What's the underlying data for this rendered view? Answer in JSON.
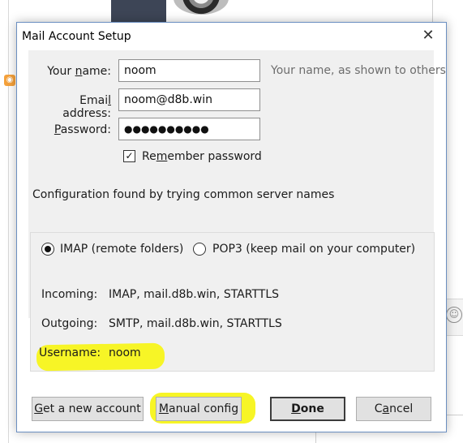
{
  "dialog": {
    "title": "Mail Account Setup",
    "close_label": "✕"
  },
  "form": {
    "name_label": "Your name:",
    "name_value": "noom",
    "name_hint": "Your name, as shown to others",
    "email_label": "Email address:",
    "email_value": "noom@d8b.win",
    "password_label": "Password:",
    "password_mask": "●●●●●●●●●●",
    "remember_label": "Remember password",
    "remember_checked": true
  },
  "status": {
    "message": "Configuration found by trying common server names"
  },
  "protocol": {
    "imap_label": "IMAP (remote folders)",
    "pop3_label": "POP3 (keep mail on your computer)",
    "selected": "IMAP"
  },
  "servers": {
    "incoming_label": "Incoming:",
    "incoming_value": "IMAP, mail.d8b.win, STARTTLS",
    "outgoing_label": "Outgoing:",
    "outgoing_value": "SMTP, mail.d8b.win, STARTTLS",
    "username_label": "Username:",
    "username_value": "noom"
  },
  "buttons": {
    "get_account": "Get a new account",
    "manual_config": "Manual config",
    "done": "Done",
    "cancel": "Cancel"
  },
  "colors": {
    "highlight": "#f7f526",
    "dialog_border": "#6b8fc1",
    "panel_bg": "#f0f0f0"
  },
  "icons": {
    "feed": "rss-feed-icon",
    "emoji": "smiley-icon",
    "close": "close-icon"
  }
}
